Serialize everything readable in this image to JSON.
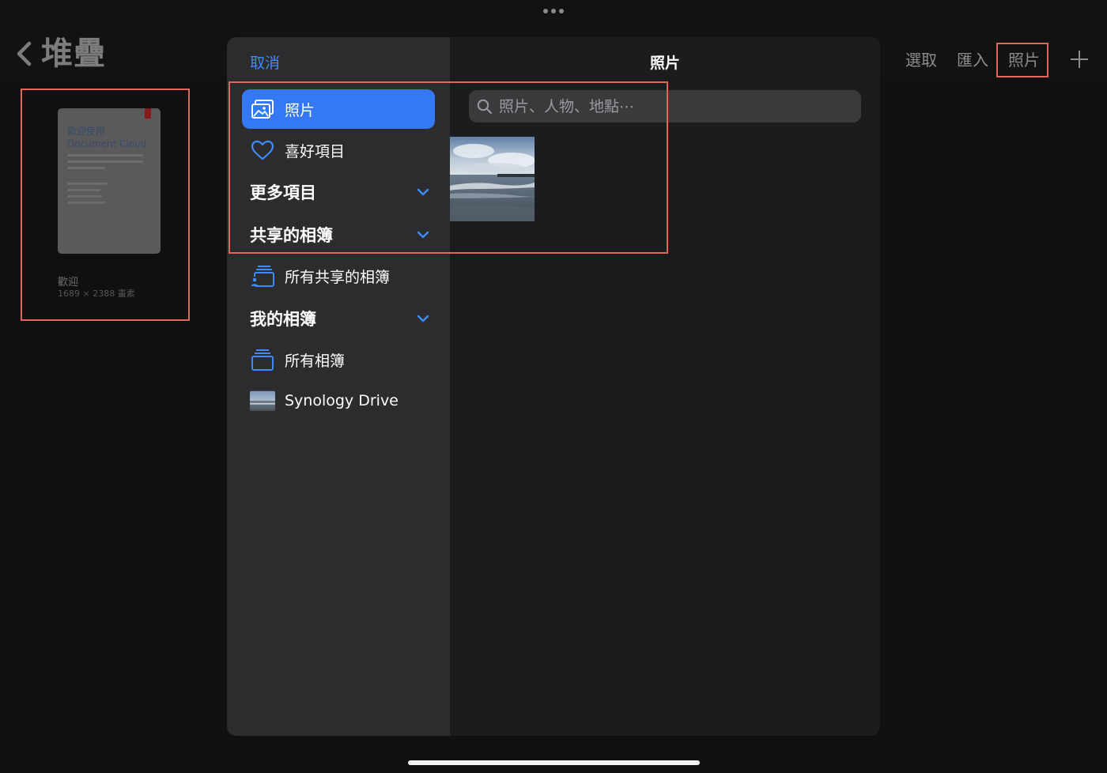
{
  "background": {
    "back_title": "堆疊",
    "nav_actions": {
      "select": "選取",
      "import": "匯入",
      "photos": "照片"
    },
    "document": {
      "thumb_title_line1": "歡迎使用",
      "thumb_title_line2": "Document Cloud",
      "name": "歡迎",
      "size": "1689 × 2388 畫素"
    }
  },
  "picker": {
    "cancel_label": "取消",
    "title": "照片",
    "search": {
      "placeholder": "照片、人物、地點⋯"
    },
    "sidebar": {
      "photos": "照片",
      "favorites": "喜好項目",
      "more_items": "更多項目",
      "shared_albums": "共享的相簿",
      "all_shared_albums": "所有共享的相簿",
      "my_albums": "我的相簿",
      "all_albums": "所有相簿",
      "synology_drive": "Synology Drive"
    }
  },
  "colors": {
    "accent": "#3478f6",
    "link": "#3d8bff",
    "highlight": "#e5655a"
  },
  "icons": [
    "ellipsis-icon",
    "chevron-left-icon",
    "plus-icon",
    "photos-icon",
    "heart-icon",
    "chevron-down-icon",
    "shared-album-icon",
    "album-stack-icon",
    "search-icon"
  ]
}
